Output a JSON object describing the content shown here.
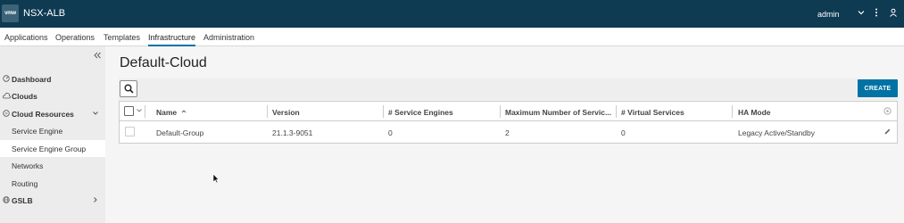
{
  "header": {
    "logo_text": "vmw",
    "app_title": "NSX-ALB",
    "user": "admin",
    "icons": [
      "chevron-down-icon",
      "more-vertical-icon",
      "user-icon"
    ]
  },
  "nav": {
    "tabs": [
      {
        "label": "Applications"
      },
      {
        "label": "Operations"
      },
      {
        "label": "Templates"
      },
      {
        "label": "Infrastructure",
        "active": true
      },
      {
        "label": "Administration"
      }
    ]
  },
  "sidebar": {
    "collapse_icon": "double-chevron-left-icon",
    "items": [
      {
        "label": "Dashboard",
        "icon": "dashboard-icon"
      },
      {
        "label": "Clouds",
        "icon": "cloud-icon"
      },
      {
        "label": "Cloud Resources",
        "icon": "cloud-resources-icon",
        "expanded": true
      },
      {
        "label": "Service Engine"
      },
      {
        "label": "Service Engine Group",
        "active": true
      },
      {
        "label": "Networks"
      },
      {
        "label": "Routing"
      },
      {
        "label": "GSLB",
        "icon": "globe-icon"
      }
    ]
  },
  "main": {
    "title": "Default-Cloud",
    "create_label": "CREATE",
    "search_icon": "search-icon",
    "columns": [
      "Name",
      "Version",
      "# Service Engines",
      "Maximum Number of Servic...",
      "# Virtual Services",
      "HA Mode"
    ],
    "sort_column": "Name",
    "rows": [
      {
        "name": "Default-Group",
        "version": "21.1.3-9051",
        "service_engines": "0",
        "max_services": "2",
        "virtual_services": "0",
        "ha_mode": "Legacy Active/Standby"
      }
    ]
  },
  "colors": {
    "header_bg": "#0e3a52",
    "accent": "#0072a3",
    "sidebar_bg": "#ececec"
  }
}
